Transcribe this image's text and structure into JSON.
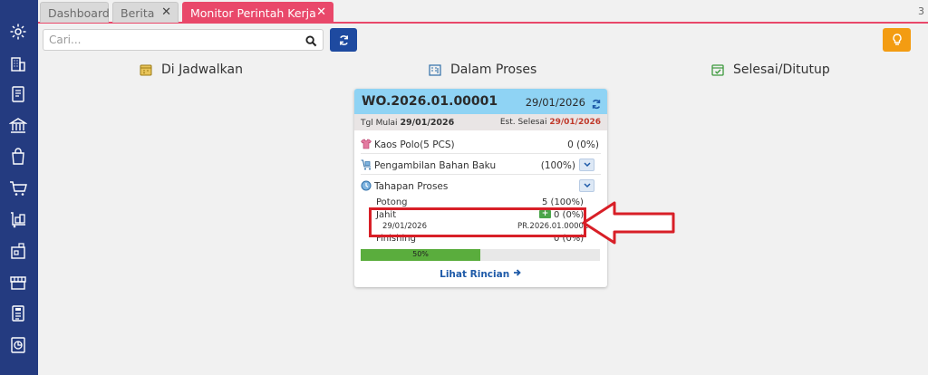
{
  "tabs": [
    {
      "label": "Dashboard",
      "closable": false
    },
    {
      "label": "Berita",
      "closable": true
    },
    {
      "label": "Monitor Perintah Kerja",
      "closable": true,
      "active": true
    }
  ],
  "tab_count": "3",
  "search": {
    "placeholder": "Cari...",
    "value": ""
  },
  "columns": {
    "scheduled": "Di Jadwalkan",
    "in_process": "Dalam Proses",
    "done": "Selesai/Ditutup"
  },
  "card": {
    "wo_number": "WO.2026.01.00001",
    "wo_date": "29/01/2026",
    "start_label": "Tgl Mulai",
    "start_date": "29/01/2026",
    "est_label": "Est. Selesai",
    "est_date": "29/01/2026",
    "product": {
      "label": "Kaos Polo(5 PCS)",
      "value": "0 (0%)"
    },
    "material": {
      "label": "Pengambilan Bahan Baku",
      "value": "(100%)"
    },
    "process_label": "Tahapan Proses",
    "stages": [
      {
        "name": "Potong",
        "value": "5 (100%)"
      },
      {
        "name": "Jahit",
        "value": "0 (0%)",
        "date": "29/01/2026",
        "ref": "PR.2026.01.00001"
      },
      {
        "name": "Finishing",
        "value": "0 (0%)"
      }
    ],
    "progress": {
      "percent": 50,
      "label": "50%"
    },
    "detail_link": "Lihat Rincian"
  },
  "colors": {
    "sidebar": "#243b80",
    "active_tab": "#e9486a",
    "card_header": "#8fd3f4",
    "progress": "#5aad3d",
    "highlight": "#d81f27"
  }
}
